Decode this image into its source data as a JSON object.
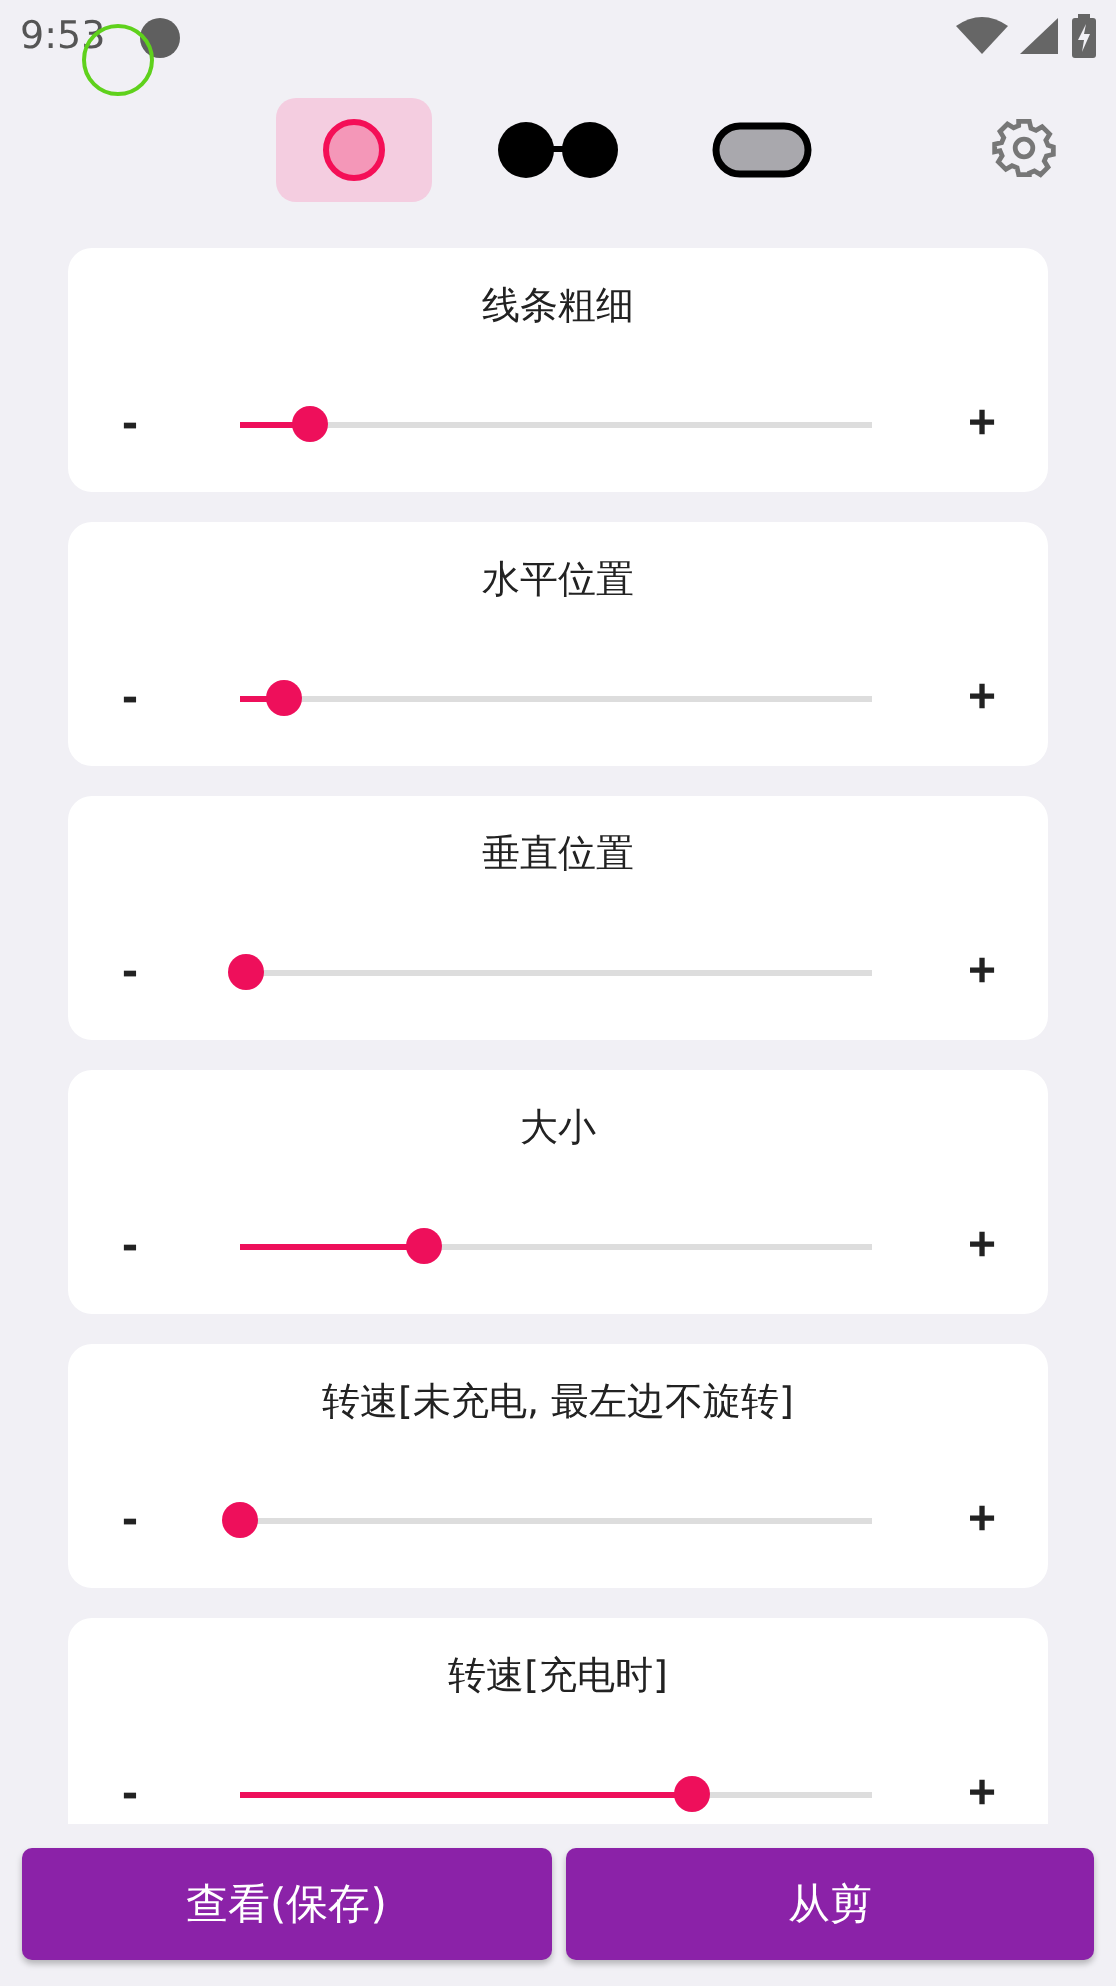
{
  "status_bar": {
    "time": "9:53"
  },
  "modes": [
    {
      "kind": "dot",
      "selected": true
    },
    {
      "kind": "pair",
      "selected": false
    },
    {
      "kind": "pill",
      "selected": false
    }
  ],
  "sliders": [
    {
      "label": "线条粗细",
      "minus": "-",
      "plus": "+",
      "level": 0.11
    },
    {
      "label": "水平位置",
      "minus": "-",
      "plus": "+",
      "level": 0.07
    },
    {
      "label": "垂直位置",
      "minus": "-",
      "plus": "+",
      "level": 0.01
    },
    {
      "label": "大小",
      "minus": "-",
      "plus": "+",
      "level": 0.29
    },
    {
      "label": "转速[未充电, 最左边不旋转]",
      "minus": "-",
      "plus": "+",
      "level": 0
    },
    {
      "label": "转速[充电时]",
      "minus": "-",
      "plus": "+",
      "level": 0.715
    }
  ],
  "buttons": [
    "查看(保存)",
    "从剪"
  ]
}
